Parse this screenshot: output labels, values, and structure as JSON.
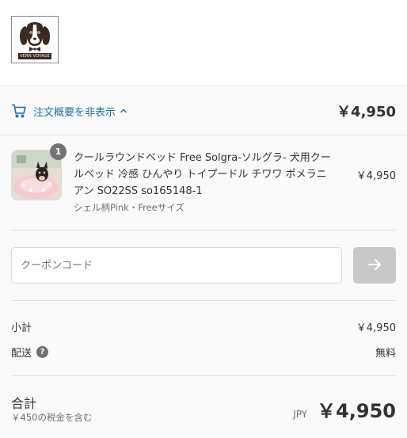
{
  "header": {
    "logo_text": "VERN VOYAGE",
    "logo_icon": "dog-logo-icon"
  },
  "summary": {
    "cart_icon": "cart-icon",
    "toggle_label": "注文概要を非表示",
    "toggle_icon": "chevron-up-icon",
    "total": "￥4,950"
  },
  "product": {
    "quantity": "1",
    "name": "クールラウンドベッド Free Solgra-ソルグラ- 犬用クールベッド 冷感 ひんやり トイプードル チワワ ポメラニアン SO22SS so165148-1",
    "variant": "シェル柄Pink・Freeサイズ",
    "price": "￥4,950"
  },
  "coupon": {
    "placeholder": "クーポンコード",
    "value": "",
    "apply_icon": "arrow-right-icon"
  },
  "costs": {
    "subtotal_label": "小計",
    "subtotal_value": "￥4,950",
    "shipping_label": "配送",
    "shipping_help": "?",
    "shipping_value": "無料"
  },
  "total": {
    "label": "合計",
    "tax_note": "￥450の税金を含む",
    "currency": "JPY",
    "value": "￥4,950"
  },
  "colors": {
    "link": "#1f6fa9",
    "apply_button_disabled": "#c8c8c8",
    "badge": "#737373"
  }
}
